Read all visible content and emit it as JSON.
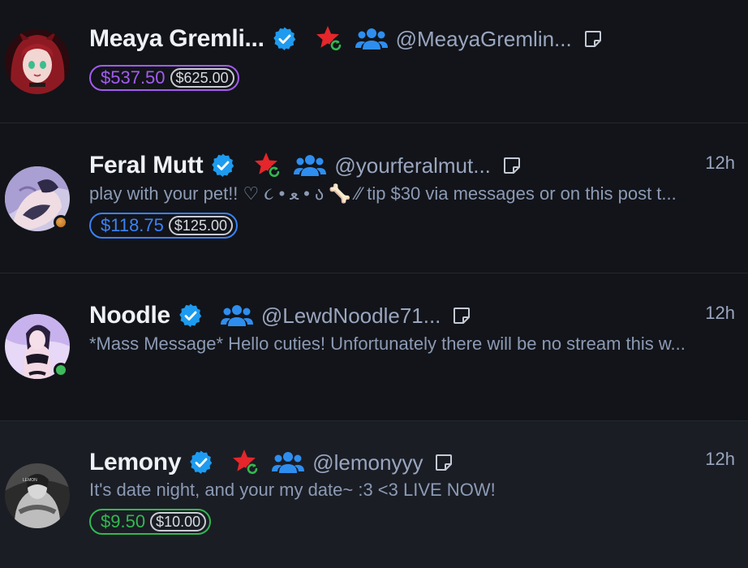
{
  "colors": {
    "purple": "#a35cf0",
    "blue": "#3b82f6",
    "green": "#33b850",
    "verified": "#1d9bf0",
    "star": "#e5262b"
  },
  "conversations": [
    {
      "name": "Meaya Gremli...",
      "handle": "@MeayaGremlin...",
      "time": "",
      "preview": "",
      "price_current": "$537.50",
      "price_original": "$625.00",
      "price_color": "purple",
      "icons": [
        "verified-icon",
        "star-refresh-icon",
        "group-icon",
        "note-icon"
      ]
    },
    {
      "name": "Feral Mutt",
      "handle": "@yourferalmut...",
      "time": "12h",
      "preview": "play with your pet!! ♡ ૮ • ﻌ • ა 🦴 ⁄⁄ tip $30 via messages or on this post t...",
      "price_current": "$118.75",
      "price_original": "$125.00",
      "price_color": "blue",
      "status": "away",
      "icons": [
        "verified-icon",
        "star-refresh-icon",
        "group-icon",
        "note-icon"
      ]
    },
    {
      "name": "Noodle",
      "handle": "@LewdNoodle71...",
      "time": "12h",
      "preview": "*Mass Message* Hello cuties! Unfortunately there will be no stream this w...",
      "status": "online",
      "icons": [
        "verified-icon",
        "group-icon",
        "note-icon"
      ]
    },
    {
      "name": "Lemony",
      "handle": "@lemonyyy",
      "time": "12h",
      "preview": "It's date night, and your my date~ :3 <3 LIVE NOW!",
      "price_current": "$9.50",
      "price_original": "$10.00",
      "price_color": "green",
      "icons": [
        "verified-icon",
        "star-refresh-icon",
        "group-icon",
        "note-icon"
      ]
    }
  ]
}
